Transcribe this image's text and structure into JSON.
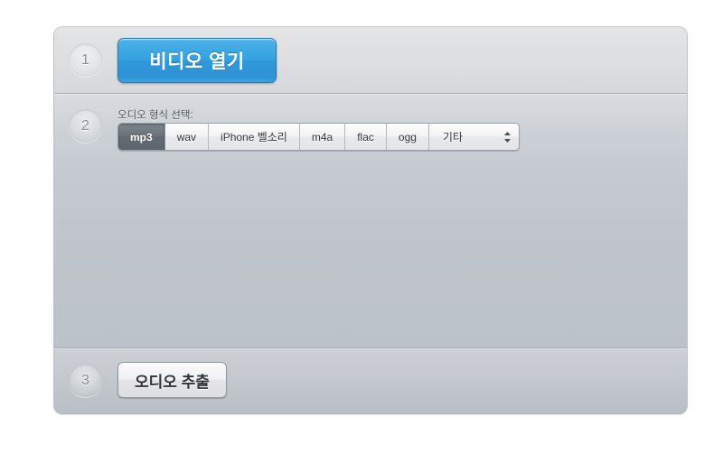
{
  "window": {
    "background_color": "#ffffff",
    "panel_background_color": "#c0c6cc"
  },
  "steps": [
    {
      "number": "1",
      "name": "open-video",
      "primary_button_label": "비디오 열기",
      "accent_color": "#2f97d8"
    },
    {
      "number": "2",
      "name": "choose-format",
      "label": "오디오 형식 선택:",
      "segmented_control": {
        "selected_value": "mp3",
        "popup_value": "기타",
        "options": [
          {
            "label": "mp3",
            "selected": true,
            "type": "segment"
          },
          {
            "label": "wav",
            "selected": false,
            "type": "segment"
          },
          {
            "label": "iPhone 벨소리",
            "selected": false,
            "type": "segment"
          },
          {
            "label": "m4a",
            "selected": false,
            "type": "segment"
          },
          {
            "label": "flac",
            "selected": false,
            "type": "segment"
          },
          {
            "label": "ogg",
            "selected": false,
            "type": "segment"
          },
          {
            "label": "기타",
            "selected": false,
            "type": "popup"
          }
        ]
      }
    },
    {
      "number": "3",
      "name": "extract-audio",
      "button_label": "오디오 추출"
    }
  ],
  "icons": {
    "stepper": "stepper-up-down-icon"
  }
}
